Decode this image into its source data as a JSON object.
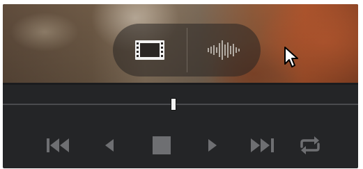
{
  "colors": {
    "panel_bg": "#242527",
    "icon_gray": "#6e6f72",
    "icon_light": "#e8e8e8",
    "wave_gray": "#a9a39c",
    "handle": "#f2f2f2"
  },
  "view_toggle": {
    "options": [
      {
        "icon": "film-strip-icon",
        "selected": true
      },
      {
        "icon": "audio-waveform-icon",
        "selected": false
      }
    ]
  },
  "scrubber": {
    "playhead_position_fraction": 0.48
  },
  "transport": {
    "buttons": [
      {
        "icon": "skip-to-start-icon"
      },
      {
        "icon": "play-reverse-icon"
      },
      {
        "icon": "stop-icon"
      },
      {
        "icon": "play-icon"
      },
      {
        "icon": "skip-to-end-icon"
      },
      {
        "icon": "loop-icon"
      }
    ]
  }
}
